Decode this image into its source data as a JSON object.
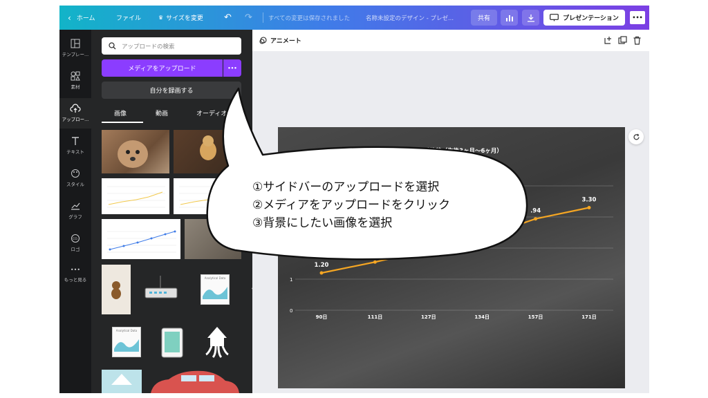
{
  "topbar": {
    "home": "ホーム",
    "file": "ファイル",
    "resize": "サイズを変更",
    "status": "すべての変更は保存されました",
    "doc_title": "名称未設定のデザイン - プレゼ...",
    "share": "共有",
    "present": "プレゼンテーション",
    "more": "•••"
  },
  "rail": {
    "items": [
      {
        "label": "テンプレー...",
        "icon": "template-icon"
      },
      {
        "label": "素材",
        "icon": "elements-icon"
      },
      {
        "label": "アップロー...",
        "icon": "upload-cloud-icon"
      },
      {
        "label": "テキスト",
        "icon": "text-icon"
      },
      {
        "label": "スタイル",
        "icon": "palette-icon"
      },
      {
        "label": "グラフ",
        "icon": "chart-icon"
      },
      {
        "label": "ロゴ",
        "icon": "logo-icon"
      },
      {
        "label": "もっと見る",
        "icon": "more-icon"
      }
    ]
  },
  "panel": {
    "search_placeholder": "アップロードの検索",
    "upload_label": "メディアをアップロード",
    "upload_more": "•••",
    "record_label": "自分を録画する",
    "tabs": [
      "画像",
      "動画",
      "オーディオ"
    ],
    "thumb_texts": [
      "Analytical Data",
      "Analytical Data"
    ]
  },
  "canvas": {
    "animate": "アニメート"
  },
  "chart_data": {
    "type": "line",
    "title": "ハルの体重推移（生後3ヶ月〜6ヶ月）",
    "categories": [
      "90日",
      "111日",
      "127日",
      "134日",
      "157日",
      "171日"
    ],
    "values": [
      1.2,
      1.55,
      1.95,
      2.35,
      2.94,
      3.3
    ],
    "visible_data_labels": [
      "1.20",
      ".94",
      "3.30"
    ],
    "ylim": [
      0,
      4
    ],
    "y_ticks_visible": [
      "1",
      "0"
    ],
    "grid": true,
    "line_color": "#f5a623"
  },
  "callout": {
    "lines": [
      "①サイドバーのアップロードを選択",
      "②メディアをアップロードをクリック",
      "③背景にしたい画像を選択"
    ]
  }
}
